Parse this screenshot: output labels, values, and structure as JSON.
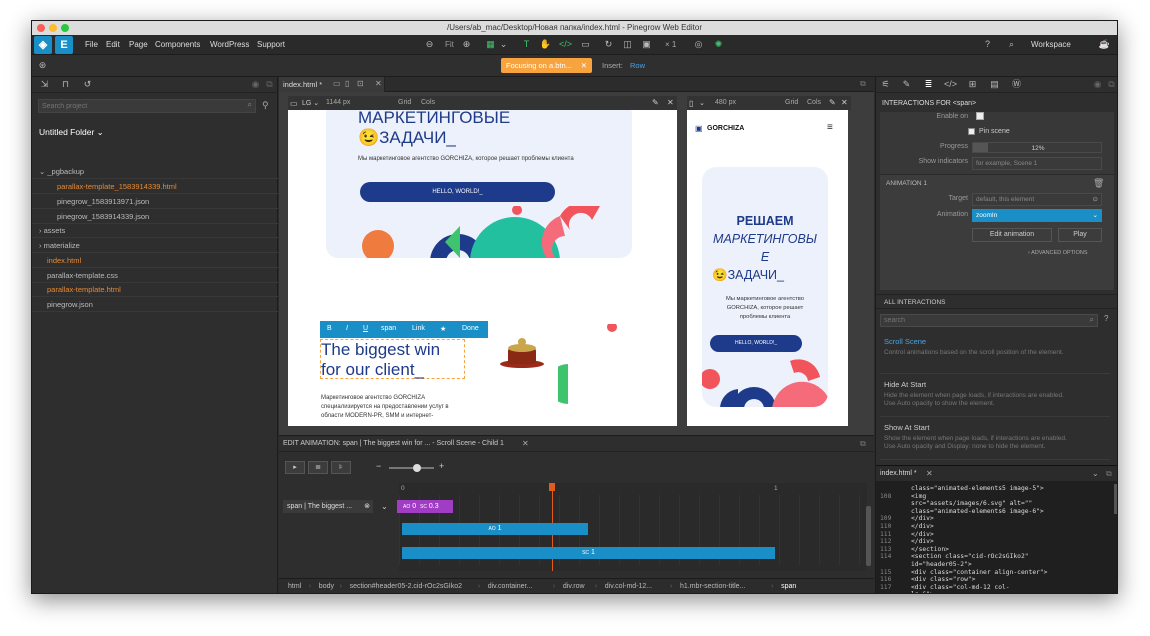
{
  "window": {
    "title": "/Users/ab_mac/Desktop/Новая папка/index.html - Pinegrow Web Editor"
  },
  "menu": [
    "File",
    "Edit",
    "Page",
    "Components",
    "WordPress",
    "Support"
  ],
  "toolbar": {
    "fit": "Fit",
    "zoom_multiplier": "× 1",
    "workspace": "Workspace"
  },
  "focus_badge": {
    "label": "Focusing on a.btn...",
    "insert_label": "Insert:",
    "insert_value": "Row"
  },
  "project": {
    "search_placeholder": "Search project",
    "folder": "Untitled Folder",
    "items": [
      {
        "label": "_pgbackup",
        "type": "folder-open"
      },
      {
        "label": "parallax-template_1583914339.html",
        "type": "file-orange"
      },
      {
        "label": "pinegrow_1583913971.json",
        "type": "file"
      },
      {
        "label": "pinegrow_1583914339.json",
        "type": "file"
      },
      {
        "label": "assets",
        "type": "folder"
      },
      {
        "label": "materialize",
        "type": "folder"
      },
      {
        "label": "index.html",
        "type": "file-orange-top"
      },
      {
        "label": "parallax-template.css",
        "type": "file-top"
      },
      {
        "label": "parallax-template.html",
        "type": "file-orange-top"
      },
      {
        "label": "pinegrow.json",
        "type": "file-top"
      }
    ]
  },
  "canvas": {
    "tab": "index.html *",
    "lg": {
      "size": "LG",
      "width": "1144 px",
      "grid": "Grid",
      "cols": "Cols"
    },
    "mobile": {
      "width": "480 px",
      "grid": "Grid",
      "cols": "Cols"
    },
    "hero_title_l1": "МАРКЕТИНГОВЫЕ",
    "hero_title_l2": "😉ЗАДАЧИ_",
    "hero_sub": "Мы маркетинговое агентство GORCHIZA, которое решает проблемы клиента",
    "hero_btn": "HELLO, WORLD!_",
    "format_bar": [
      "B",
      "I",
      "U",
      "span",
      "Link",
      "★",
      "Done"
    ],
    "biggest_win_l1": "The biggest win",
    "biggest_win_l2": "for our client_",
    "body_text_l1": "Маркетинговое агентство GORCHIZA",
    "body_text_l2": "специализируется на предоставлении услуг в",
    "body_text_l3": "области MODERN-PR, SMM и интернет-",
    "mobile_brand": "GORCHIZA",
    "mobile_title_l1": "РЕШАЕМ",
    "mobile_title_l2": "МАРКЕТИНГОВЫ",
    "mobile_title_l3": "Е",
    "mobile_title_l4": "😉ЗАДАЧИ_",
    "mobile_sub_l1": "Мы маркетинговое агентство",
    "mobile_sub_l2": "GORCHIZA, которое решает",
    "mobile_sub_l3": "проблемы клиента",
    "mobile_btn": "HELLO, WORLD!_"
  },
  "animation_editor": {
    "title": "EDIT ANIMATION: span | The biggest win for ... - Scroll Scene - Child 1",
    "scale_labels": [
      "0",
      "1"
    ],
    "track_label": "span | The biggest ...",
    "track_badge_ao": "AO",
    "track_badge_ao_val": "0",
    "track_badge_sc": "SC",
    "track_badge_sc_val": "0.3",
    "bar1_ao": "AO",
    "bar1_val": "1",
    "bar2_sc": "SC",
    "bar2_val": "1"
  },
  "breadcrumb": [
    "html",
    "body",
    "section#header05-2.cid-rOc2sGIko2",
    "div.container...",
    "div.row",
    "div.col-md-12...",
    "h1.mbr-section-title...",
    "span"
  ],
  "interactions": {
    "header": "INTERACTIONS FOR  <span>",
    "enable_on": "Enable on",
    "pin_scene": "Pin scene",
    "progress_label": "Progress",
    "progress_value": "12%",
    "progress_fraction": 0.12,
    "show_indicators_label": "Show indicators",
    "show_indicators_placeholder": "for example, Scene 1",
    "animation_section": "ANIMATION 1",
    "target_label": "Target",
    "target_placeholder": "default, this element",
    "animation_label": "Animation",
    "animation_value": "zoomIn",
    "edit_animation": "Edit animation",
    "play": "Play",
    "advanced": "ADVANCED OPTIONS",
    "all_interactions": "ALL INTERACTIONS",
    "search_placeholder": "search",
    "list": [
      {
        "title": "Scroll Scene",
        "desc_l1": "Control animations based on the scroll position of the element.",
        "desc_l2": "",
        "active": true
      },
      {
        "title": "Hide At Start",
        "desc_l1": "Hide the element when page loads, if interactions are enabled.",
        "desc_l2": "Use Auto opacity to show the element.",
        "active": false
      },
      {
        "title": "Show At Start",
        "desc_l1": "Show the element when page loads, if interactions are enabled.",
        "desc_l2": "Use Auto opacity and Display: none to hide the element.",
        "active": false
      },
      {
        "title": "Smooth Scroll",
        "desc_l1": "",
        "desc_l2": "",
        "active": false
      }
    ]
  },
  "code": {
    "tab": "index.html *",
    "lines": [
      {
        "n": "",
        "t": "class=\"animated-elements5 image-5\">"
      },
      {
        "n": "108",
        "t": "                  <img"
      },
      {
        "n": "",
        "t": "src=\"assets/images/6.svg\" alt=\"\""
      },
      {
        "n": "",
        "t": "class=\"animated-elements6 image-6\">"
      },
      {
        "n": "109",
        "t": "              </div>"
      },
      {
        "n": "110",
        "t": "            </div>"
      },
      {
        "n": "111",
        "t": "          </div>"
      },
      {
        "n": "112",
        "t": "        </div>"
      },
      {
        "n": "113",
        "t": "      </section>"
      },
      {
        "n": "114",
        "t": "      <section class=\"cid-rOc2sGIko2\""
      },
      {
        "n": "",
        "t": "id=\"header05-2\">"
      },
      {
        "n": "115",
        "t": "        <div class=\"container align-center\">"
      },
      {
        "n": "116",
        "t": "          <div class=\"row\">"
      },
      {
        "n": "117",
        "t": "            <div class=\"col-md-12 col-"
      },
      {
        "n": "",
        "t": "lg-6\">"
      }
    ]
  },
  "colors": {
    "accent": "#1a8fc7",
    "orange": "#e78a35",
    "navy": "#1e3a8a",
    "focus": "#f7a440"
  }
}
